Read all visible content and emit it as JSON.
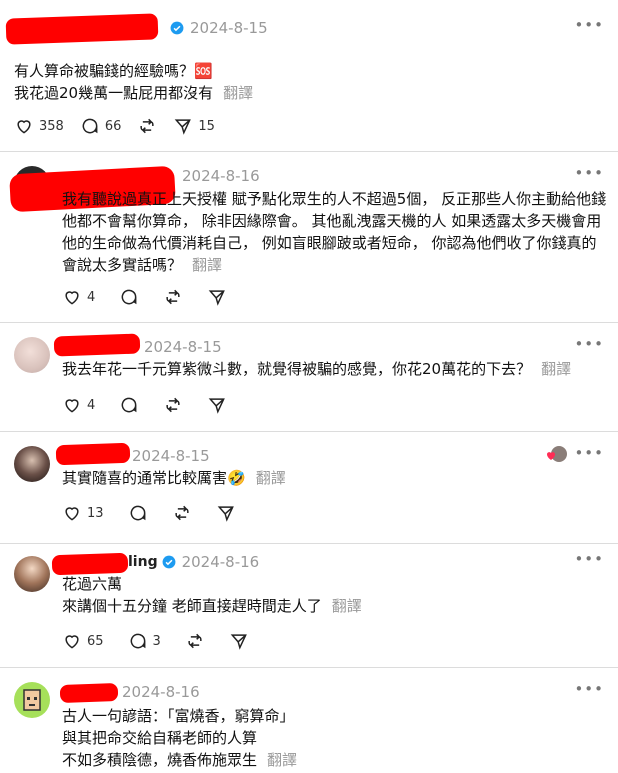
{
  "posts": [
    {
      "date": "2024-8-15",
      "lines": [
        "有人算命被騙錢的經驗嗎？🆘",
        "我花過20幾萬一點屁用都沒有"
      ],
      "translate": "翻譯",
      "likes": "358",
      "replies": "66",
      "reposts": "",
      "shares": "15",
      "verified": true
    },
    {
      "date": "2024-8-16",
      "lines": [
        "我有聽說過真正上天授權 賦予點化眾生的人不超過5個，  反正那些人你主動給他錢",
        "他都不會幫你算命，  除非因緣際會。  其他亂洩露天機的人 如果透露太多天機會用",
        "他的生命做為代價消耗自己，  例如盲眼腳跛或者短命，  你認為他們收了你錢真的",
        "會說太多實話嗎？"
      ],
      "translate": "翻譯",
      "likes": "4",
      "replies": "",
      "reposts": "",
      "shares": ""
    },
    {
      "date": "2024-8-15",
      "lines": [
        "我去年花一千元算紫微斗數，就覺得被騙的感覺，你花20萬花的下去？"
      ],
      "translate": "翻譯",
      "likes": "4",
      "replies": "",
      "reposts": "",
      "shares": ""
    },
    {
      "date": "2024-8-15",
      "lines": [
        "其實隨喜的通常比較厲害🤣"
      ],
      "translate": "翻譯",
      "likes": "13",
      "replies": "",
      "reposts": "",
      "shares": ""
    },
    {
      "username_visible": "ling",
      "date": "2024-8-16",
      "lines": [
        "花過六萬",
        "來講個十五分鐘 老師直接趕時間走人了"
      ],
      "translate": "翻譯",
      "likes": "65",
      "replies": "3",
      "reposts": "",
      "shares": "",
      "verified": true
    },
    {
      "date": "2024-8-16",
      "lines": [
        "古人一句諺語：「富燒香，窮算命」",
        "與其把命交給自稱老師的人算",
        "不如多積陰德，燒香佈施眾生"
      ],
      "translate": "翻譯"
    }
  ],
  "colors": {
    "redaction": "#ff0000",
    "verified": "#1d9bf0",
    "muted": "#999999",
    "heart": "#ff2d55"
  },
  "icons": [
    "heart-icon",
    "comment-icon",
    "repost-icon",
    "share-icon",
    "more-icon",
    "verified-icon"
  ]
}
